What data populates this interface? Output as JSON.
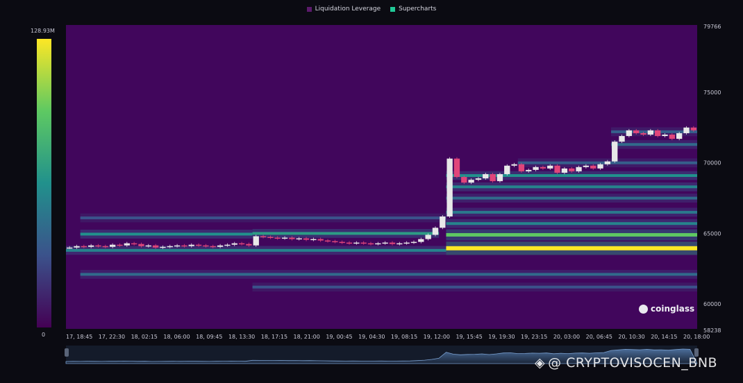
{
  "legend": [
    {
      "label": "Liquidation Leverage",
      "color": "#5b1a6b"
    },
    {
      "label": "Supercharts",
      "color": "#20c997"
    }
  ],
  "scale": {
    "max_label": "128.93M",
    "min_label": "0"
  },
  "logo_text": "coinglass",
  "watermark_text": "@ CRYPTOVISOCEN_BNB",
  "colors": {
    "background": "#41065c",
    "candle_up": "#e8e8e8",
    "candle_down": "#e0457a"
  },
  "chart_data": {
    "type": "heatmap",
    "x_ticks": [
      "17, 18:45",
      "17, 22:30",
      "18, 02:15",
      "18, 06:00",
      "18, 09:45",
      "18, 13:30",
      "18, 17:15",
      "18, 21:00",
      "19, 00:45",
      "19, 04:30",
      "19, 08:15",
      "19, 12:00",
      "19, 15:45",
      "19, 19:30",
      "19, 23:15",
      "20, 03:00",
      "20, 06:45",
      "20, 10:30",
      "20, 14:15",
      "20, 18:00"
    ],
    "y_ticks": [
      "79766",
      "75000",
      "70000",
      "65000",
      "60000",
      "58238"
    ],
    "ylim": [
      58238,
      79766
    ],
    "colorbar_range": [
      0,
      128930000
    ],
    "price_path": [
      [
        0,
        64000
      ],
      [
        1,
        64100
      ],
      [
        2,
        64050
      ],
      [
        3,
        64150
      ],
      [
        4,
        64100
      ],
      [
        5,
        64050
      ],
      [
        6,
        64200
      ],
      [
        7,
        64150
      ],
      [
        8,
        64300
      ],
      [
        9,
        64250
      ],
      [
        10,
        64100
      ],
      [
        11,
        64150
      ],
      [
        12,
        64000
      ],
      [
        13,
        64050
      ],
      [
        14,
        64100
      ],
      [
        15,
        64150
      ],
      [
        16,
        64100
      ],
      [
        17,
        64200
      ],
      [
        18,
        64150
      ],
      [
        19,
        64100
      ],
      [
        20,
        64050
      ],
      [
        21,
        64150
      ],
      [
        22,
        64200
      ],
      [
        23,
        64300
      ],
      [
        24,
        64250
      ],
      [
        25,
        64150
      ],
      [
        26,
        64800
      ],
      [
        27,
        64750
      ],
      [
        28,
        64700
      ],
      [
        29,
        64650
      ],
      [
        30,
        64700
      ],
      [
        31,
        64600
      ],
      [
        32,
        64650
      ],
      [
        33,
        64550
      ],
      [
        34,
        64600
      ],
      [
        35,
        64500
      ],
      [
        36,
        64450
      ],
      [
        37,
        64400
      ],
      [
        38,
        64350
      ],
      [
        39,
        64300
      ],
      [
        40,
        64350
      ],
      [
        41,
        64300
      ],
      [
        42,
        64250
      ],
      [
        43,
        64300
      ],
      [
        44,
        64350
      ],
      [
        45,
        64250
      ],
      [
        46,
        64300
      ],
      [
        47,
        64350
      ],
      [
        48,
        64400
      ],
      [
        49,
        64600
      ],
      [
        50,
        64900
      ],
      [
        51,
        65400
      ],
      [
        52,
        66200
      ],
      [
        53,
        70300
      ],
      [
        54,
        69000
      ],
      [
        55,
        68600
      ],
      [
        56,
        68800
      ],
      [
        57,
        68900
      ],
      [
        58,
        69200
      ],
      [
        59,
        68700
      ],
      [
        60,
        69200
      ],
      [
        61,
        69800
      ],
      [
        62,
        69900
      ],
      [
        63,
        69400
      ],
      [
        64,
        69500
      ],
      [
        65,
        69700
      ],
      [
        66,
        69600
      ],
      [
        67,
        69800
      ],
      [
        68,
        69300
      ],
      [
        69,
        69600
      ],
      [
        70,
        69400
      ],
      [
        71,
        69700
      ],
      [
        72,
        69800
      ],
      [
        73,
        69600
      ],
      [
        74,
        69900
      ],
      [
        75,
        70100
      ],
      [
        76,
        71500
      ],
      [
        77,
        71900
      ],
      [
        78,
        72300
      ],
      [
        79,
        72100
      ],
      [
        80,
        72000
      ],
      [
        81,
        72300
      ],
      [
        82,
        71900
      ],
      [
        83,
        72000
      ],
      [
        84,
        71700
      ],
      [
        85,
        72100
      ],
      [
        86,
        72500
      ],
      [
        87,
        72300
      ]
    ],
    "price_path_length": 88,
    "liquidation_bands": [
      {
        "price": 63950,
        "start": 53,
        "end": 88,
        "intensity": 1.0
      },
      {
        "price": 64900,
        "start": 53,
        "end": 88,
        "intensity": 0.75
      },
      {
        "price": 65000,
        "start": 26,
        "end": 52,
        "intensity": 0.55
      },
      {
        "price": 64950,
        "start": 2,
        "end": 26,
        "intensity": 0.5
      },
      {
        "price": 63800,
        "start": 0,
        "end": 53,
        "intensity": 0.45
      },
      {
        "price": 62100,
        "start": 2,
        "end": 88,
        "intensity": 0.35
      },
      {
        "price": 65700,
        "start": 53,
        "end": 88,
        "intensity": 0.45
      },
      {
        "price": 66500,
        "start": 53,
        "end": 88,
        "intensity": 0.4
      },
      {
        "price": 67500,
        "start": 53,
        "end": 88,
        "intensity": 0.35
      },
      {
        "price": 68300,
        "start": 53,
        "end": 88,
        "intensity": 0.45
      },
      {
        "price": 69100,
        "start": 53,
        "end": 88,
        "intensity": 0.5
      },
      {
        "price": 70000,
        "start": 63,
        "end": 88,
        "intensity": 0.3
      },
      {
        "price": 71300,
        "start": 76,
        "end": 88,
        "intensity": 0.35
      },
      {
        "price": 72200,
        "start": 76,
        "end": 88,
        "intensity": 0.3
      },
      {
        "price": 66100,
        "start": 2,
        "end": 53,
        "intensity": 0.25
      },
      {
        "price": 61200,
        "start": 26,
        "end": 88,
        "intensity": 0.25
      }
    ]
  }
}
